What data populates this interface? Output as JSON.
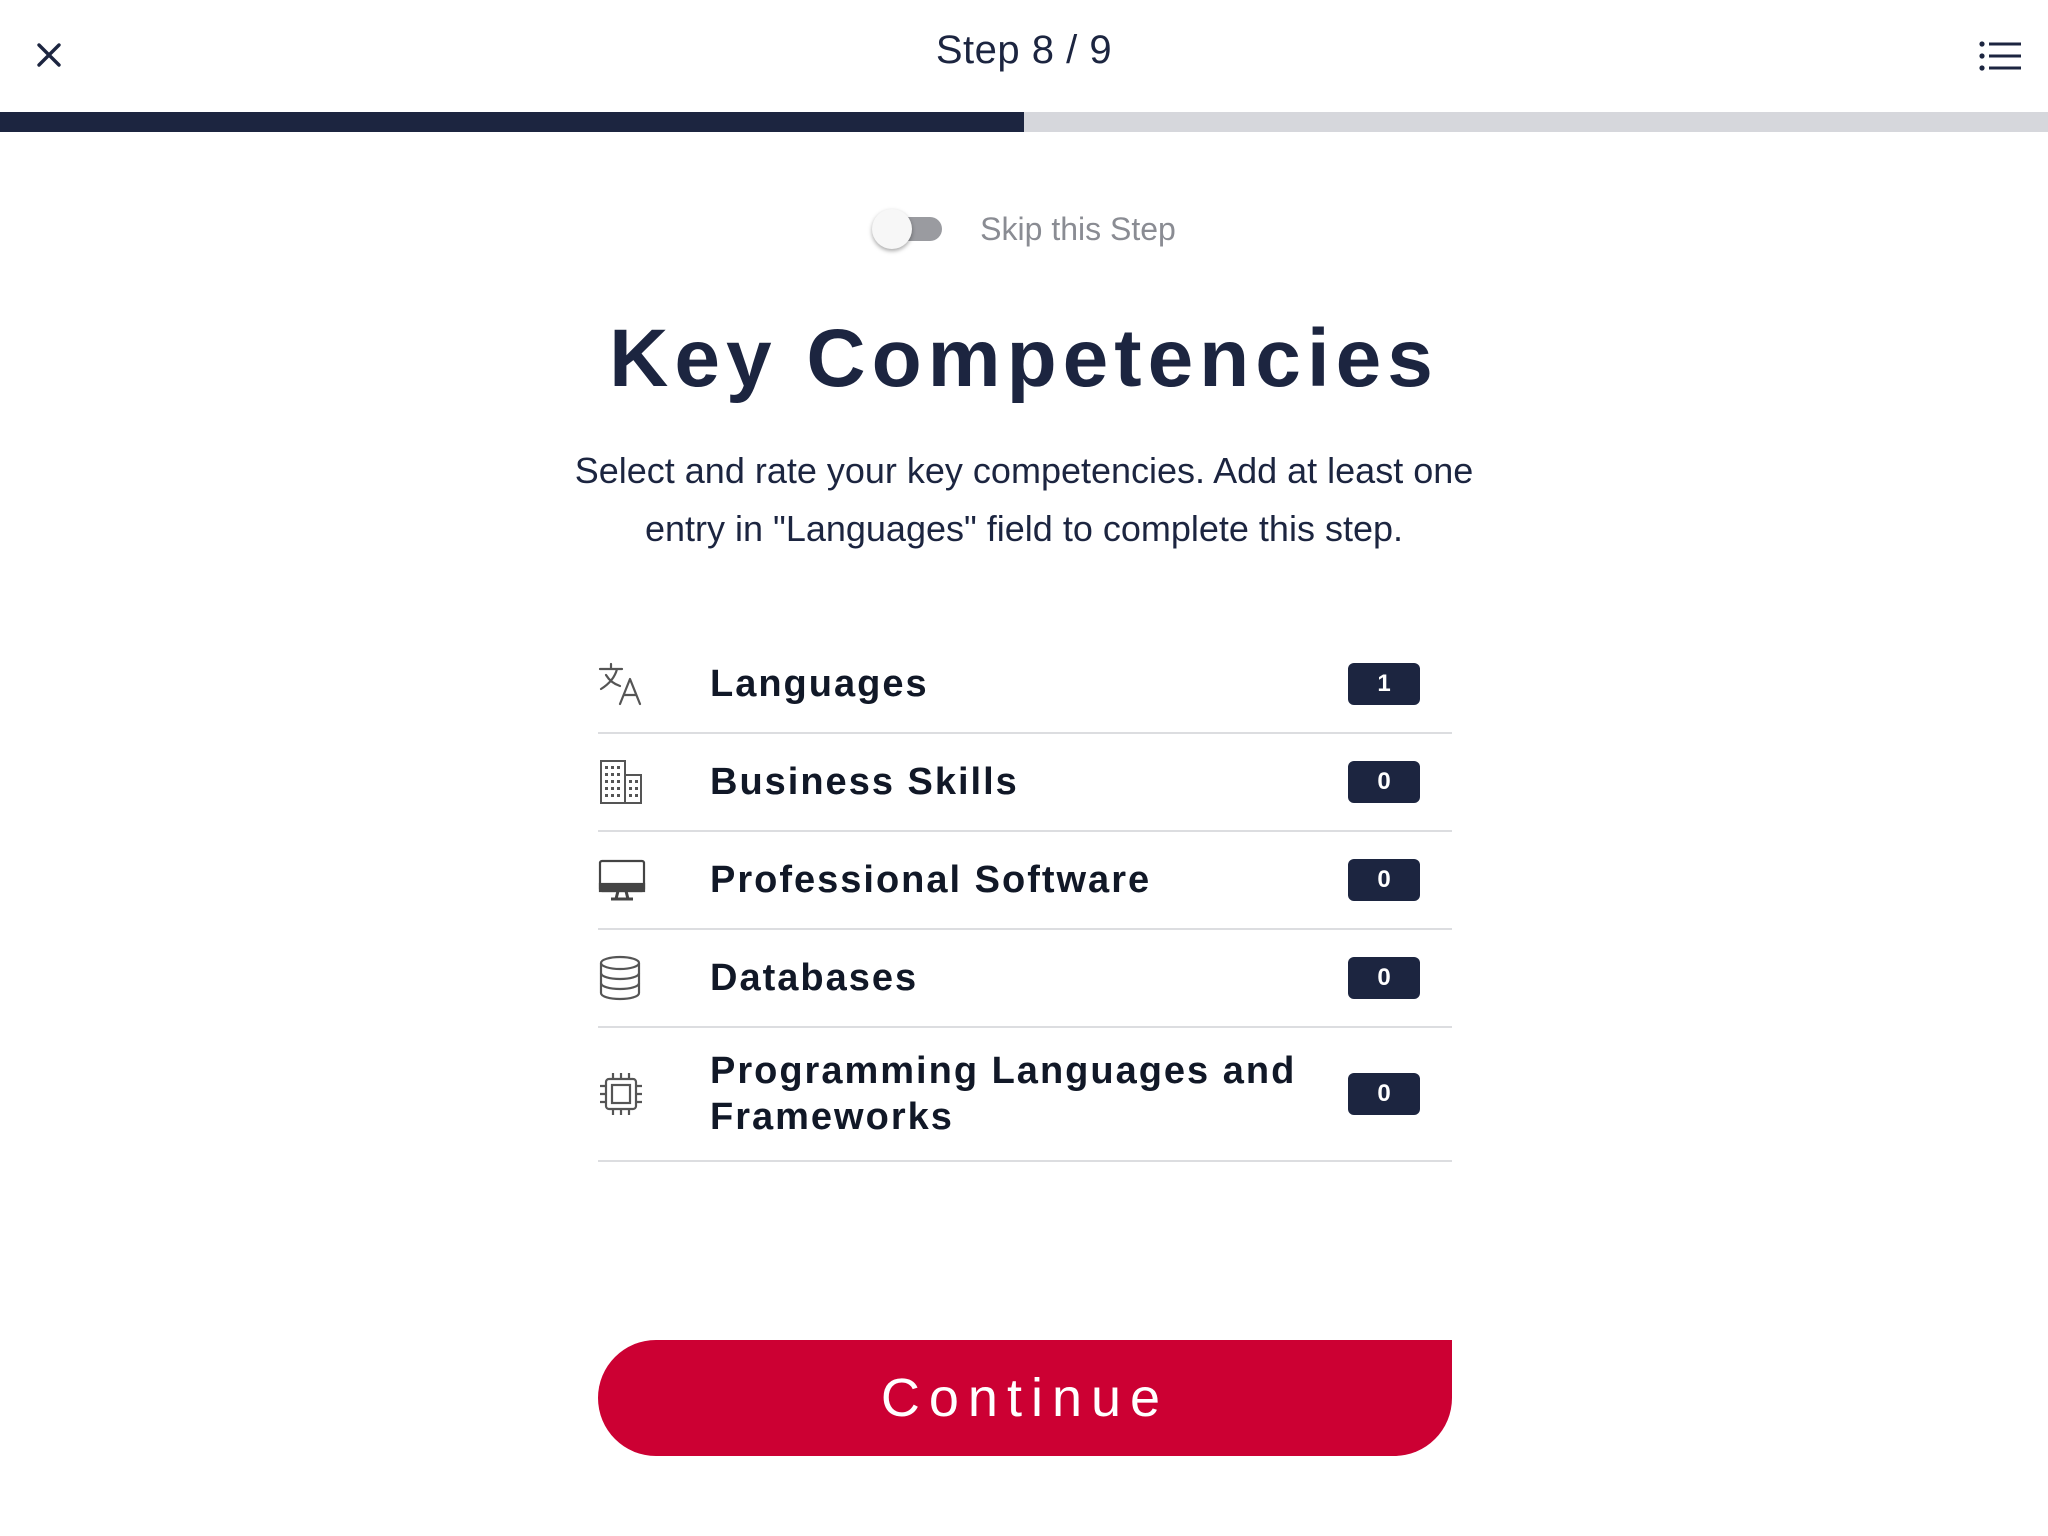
{
  "header": {
    "step_title": "Step 8 / 9",
    "close_icon": "close-icon",
    "menu_icon": "list-menu-icon"
  },
  "progress": {
    "current_step": 8,
    "total_steps": 9,
    "fraction": 0.5
  },
  "skip": {
    "label": "Skip this Step",
    "enabled": false
  },
  "page": {
    "title": "Key Competencies",
    "description": "Select and rate your key competencies. Add at least one entry in \"Languages\" field to complete this step."
  },
  "competencies": [
    {
      "label": "Languages",
      "count": "1",
      "icon": "translate-icon"
    },
    {
      "label": "Business Skills",
      "count": "0",
      "icon": "building-icon"
    },
    {
      "label": "Professional Software",
      "count": "0",
      "icon": "monitor-icon"
    },
    {
      "label": "Databases",
      "count": "0",
      "icon": "database-icon"
    },
    {
      "label": "Programming Languages and Frameworks",
      "count": "0",
      "icon": "chip-icon"
    }
  ],
  "actions": {
    "continue_label": "Continue"
  },
  "colors": {
    "primary_navy": "#1c2540",
    "accent_red": "#cc0033",
    "progress_track": "#d6d7dc"
  }
}
